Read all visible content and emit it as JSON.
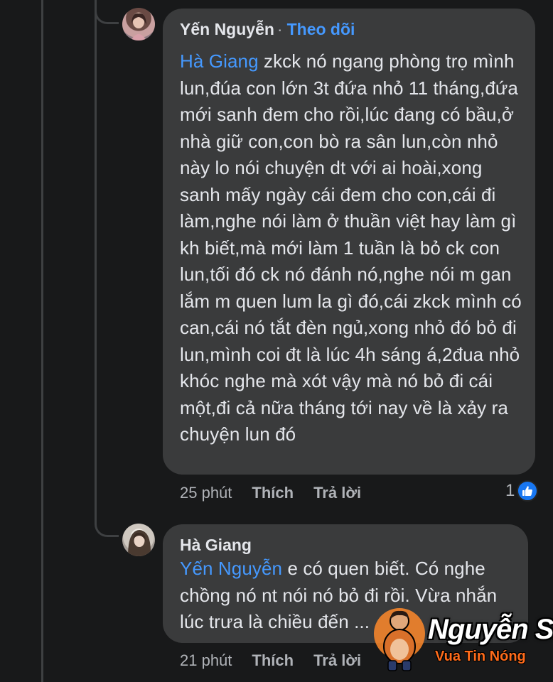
{
  "comments": [
    {
      "author": "Yến Nguyễn",
      "separator": "·",
      "follow_label": "Theo dõi",
      "mention": "Hà Giang",
      "body": "zkck nó ngang phòng trọ mình lun,đúa con lớn 3t đứa nhỏ 11 tháng,đứa mới sanh đem cho rồi,lúc đang có bầu,ở nhà giữ con,con bò ra sân lun,còn nhỏ này lo nói chuyện dt với ai hoài,xong sanh mấy ngày cái đem cho con,cái đi làm,nghe nói làm ở thuần việt hay làm gì kh biết,mà mới làm 1 tuần là bỏ ck con lun,tối đó ck nó đánh nó,nghe nói m gan lắm m quen lum la gì đó,cái zkck mình có can,cái nó tắt đèn ngủ,xong nhỏ đó bỏ đi lun,mình coi đt là lúc 4h sáng á,2đua nhỏ khóc nghe mà xót vậy mà nó bỏ đi cái một,đi cả nữa tháng tới nay về là xảy ra chuyện lun đó",
      "time": "25 phút",
      "like_label": "Thích",
      "reply_label": "Trả lời",
      "reaction_count": "1",
      "reaction_icon": "like-thumb-icon"
    },
    {
      "author": "Hà Giang",
      "mention": "Yến Nguyễn",
      "body": "e có quen biết. Có nghe chồng nó nt nói nó bỏ đi rồi. Vừa nhắn lúc trưa là chiều đến ...",
      "time": "21 phút",
      "like_label": "Thích",
      "reply_label": "Trả lời"
    }
  ],
  "watermark": {
    "name": "Nguyễn Sin",
    "tagline": "Vua Tin Nóng"
  },
  "colors": {
    "background": "#18191a",
    "bubble": "#3a3b3c",
    "text": "#e4e6eb",
    "secondary": "#b0b3b8",
    "link": "#4599ff",
    "like_blue": "#1877f2",
    "watermark_accent": "#ff6b1a"
  }
}
